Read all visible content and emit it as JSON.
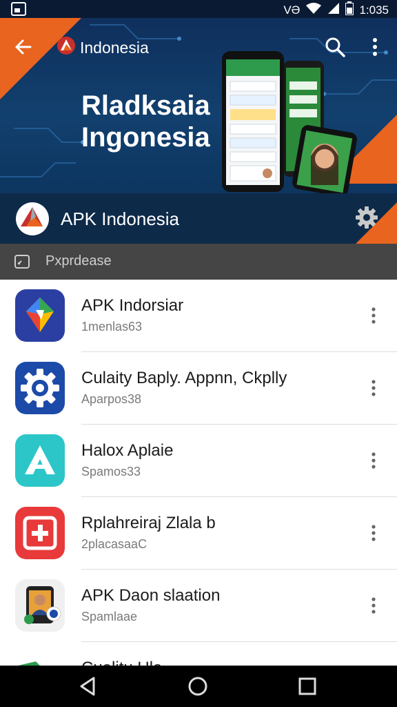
{
  "status_bar": {
    "signal_text": "VƏ",
    "time": "1:035"
  },
  "hero": {
    "brand_text": "Indonesia",
    "title": "Rladksaia Ingonesia"
  },
  "app_header": {
    "title": "APK Indonesia"
  },
  "search": {
    "placeholder": "Pxprdease"
  },
  "apps": [
    {
      "name": "APK Indorsiar",
      "sub": "1menlas63",
      "icon": "google-maps-style-icon",
      "tile_color": "#2b3fa3"
    },
    {
      "name": "Culaity Baply. Appnn, Ckplly",
      "sub": "Aparpos38",
      "icon": "gear-settings-icon",
      "tile_color": "#1c4aa8"
    },
    {
      "name": "Halox Aplaie",
      "sub": "Spamos33",
      "icon": "letter-a-icon",
      "tile_color": "#2cc6c8"
    },
    {
      "name": "Rplahreiraj Zlala  b",
      "sub": "2placasaaC",
      "icon": "red-plus-icon",
      "tile_color": "#e83a3a"
    },
    {
      "name": "APK Daon slaation",
      "sub": "Spamlaae",
      "icon": "video-call-icon",
      "tile_color": "#f0f0f0"
    },
    {
      "name": "Cualitu Ula",
      "sub": "",
      "icon": "folder-icon",
      "tile_color": "#2e9a4c"
    }
  ],
  "colors": {
    "accent": "#e9641f",
    "header": "#0e2a49",
    "hero": "#12406e"
  }
}
